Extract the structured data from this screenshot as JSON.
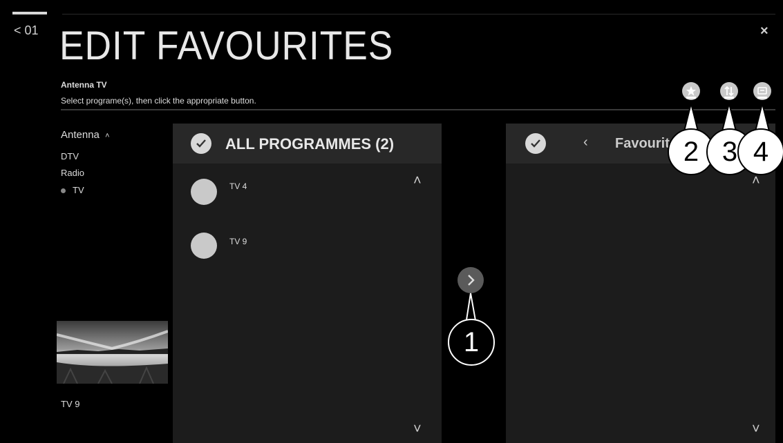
{
  "header": {
    "back_label": "< 01",
    "title": "EDIT FAVOURITES",
    "close_label": "×",
    "source": "Antenna TV",
    "instruction": "Select programe(s), then click the appropriate button."
  },
  "sidebar": {
    "group_label": "Antenna",
    "items": [
      {
        "label": "DTV"
      },
      {
        "label": "Radio"
      },
      {
        "label": "TV",
        "selected": true
      }
    ],
    "preview_label": "TV 9"
  },
  "left_panel": {
    "title": "ALL PROGRAMMES (2)",
    "programmes": [
      {
        "label": "TV 4"
      },
      {
        "label": "TV 9"
      }
    ]
  },
  "right_panel": {
    "title": "Favourites"
  },
  "toolbar": {
    "icons": [
      "favourite-group-icon",
      "sort-icon",
      "rename-icon"
    ]
  },
  "callouts": [
    "1",
    "2",
    "3",
    "4"
  ],
  "colors": {
    "background": "#000000",
    "panel": "#1c1c1c",
    "panel_header": "#282828"
  }
}
